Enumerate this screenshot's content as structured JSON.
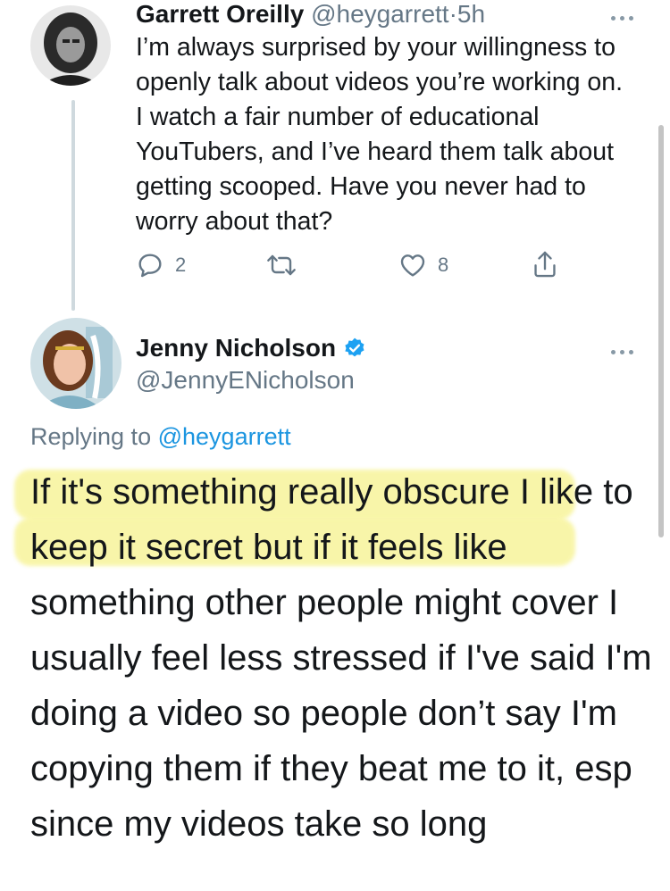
{
  "tweet1": {
    "display_name": "Garrett Oreilly",
    "handle": "@heygarrett",
    "separator": "·",
    "time": "5h",
    "text": "I’m always surprised by your willingness to openly talk about videos you’re working on. I watch a fair number of educational YouTubers, and I’ve heard them talk about getting scooped. Have you never had to worry about that?",
    "reply_count": "2",
    "retweet_count": "",
    "like_count": "8"
  },
  "tweet2": {
    "display_name": "Jenny Nicholson",
    "verified": true,
    "handle": "@JennyENicholson",
    "replying_prefix": "Replying to",
    "replying_to": "@heygarrett",
    "text": "If it's something really obscure I like to keep it secret but if it feels like something other people might cover I usually feel less stressed if I've said I'm doing a video so people don’t say I'm copying them if they beat me to it, esp since my videos take so long"
  },
  "colors": {
    "text": "#14171a",
    "secondary": "#657786",
    "link": "#1b95e0",
    "verified": "#1da1f2",
    "highlight": "#f7f392"
  },
  "icons": {
    "reply": "reply-icon",
    "retweet": "retweet-icon",
    "like": "heart-icon",
    "share": "share-icon",
    "more": "more-icon",
    "verified": "verified-badge-icon"
  }
}
